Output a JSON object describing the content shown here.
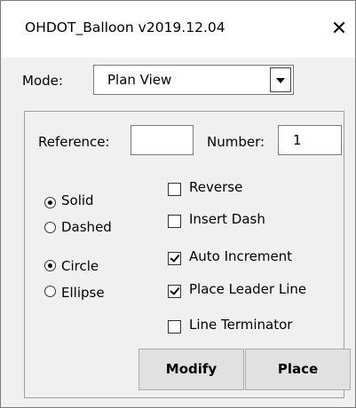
{
  "window": {
    "title": "OHDOT_Balloon v2019.12.04",
    "close_glyph": "✕"
  },
  "mode": {
    "label": "Mode:",
    "value": "Plan View"
  },
  "fields": {
    "reference_label": "Reference:",
    "reference_value": "",
    "number_label": "Number:",
    "number_value": "1"
  },
  "line_style": {
    "options": [
      {
        "label": "Solid",
        "selected": true
      },
      {
        "label": "Dashed",
        "selected": false
      }
    ]
  },
  "shape": {
    "options": [
      {
        "label": "Circle",
        "selected": true
      },
      {
        "label": "Ellipse",
        "selected": false
      }
    ]
  },
  "checkboxes": [
    {
      "label": "Reverse",
      "checked": false
    },
    {
      "label": "Insert Dash",
      "checked": false
    },
    {
      "label": "Auto Increment",
      "checked": true
    },
    {
      "label": "Place Leader Line",
      "checked": true
    },
    {
      "label": "Line Terminator",
      "checked": false
    }
  ],
  "buttons": {
    "modify_label": "Modify",
    "place_label": "Place"
  }
}
